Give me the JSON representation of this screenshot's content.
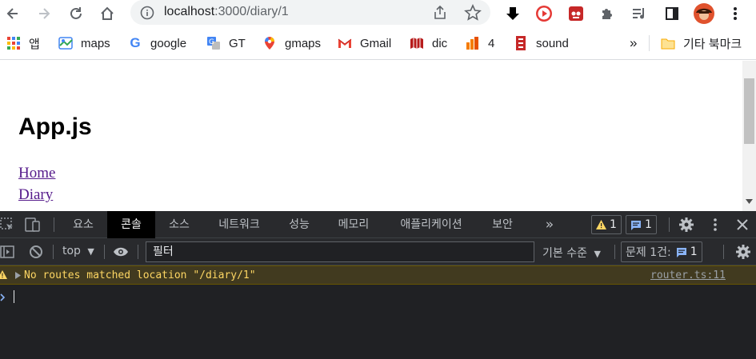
{
  "browser": {
    "url_host": "localhost",
    "url_rest": ":3000/diary/1",
    "bookmarks": [
      {
        "label": "앱",
        "icon": "apps-grid-icon"
      },
      {
        "label": "maps",
        "icon": "maps-icon"
      },
      {
        "label": "google",
        "icon": "google-icon"
      },
      {
        "label": "GT",
        "icon": "translate-icon"
      },
      {
        "label": "gmaps",
        "icon": "gmaps-pin-icon"
      },
      {
        "label": "Gmail",
        "icon": "gmail-icon"
      },
      {
        "label": "dic",
        "icon": "dictionary-icon"
      },
      {
        "label": "4",
        "icon": "bars-icon"
      },
      {
        "label": "sound",
        "icon": "sound-icon"
      }
    ],
    "overflow_label": "»",
    "other_bookmarks": "기타 북마크"
  },
  "page": {
    "heading": "App.js",
    "links": [
      "Home",
      "Diary"
    ]
  },
  "devtools": {
    "tabs": [
      "요소",
      "콘솔",
      "소스",
      "네트워크",
      "성능",
      "메모리",
      "애플리케이션",
      "보안"
    ],
    "active_tab": "콘솔",
    "more_tabs": "»",
    "warning_count": "1",
    "message_count": "1",
    "context": "top",
    "filter_placeholder": "필터",
    "level": "기본 수준",
    "issues_label": "문제 1건:",
    "issues_count": "1",
    "warning": {
      "message": "No routes matched location \"/diary/1\"",
      "source": "router.ts:11"
    },
    "colors": {
      "warning_text": "#fdd663",
      "warning_bg": "#413a1f",
      "accent": "#1a73e8"
    }
  }
}
